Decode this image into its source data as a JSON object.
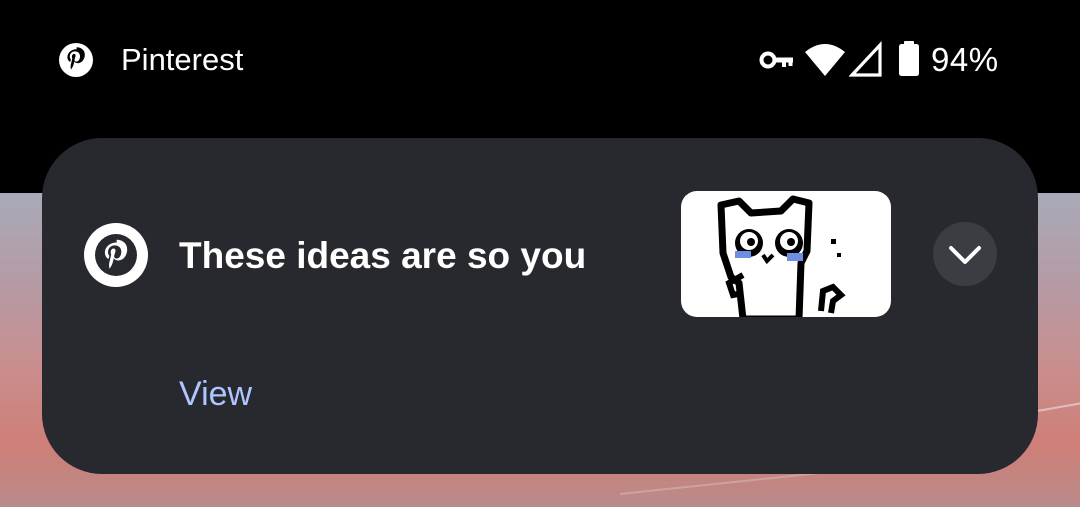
{
  "status_bar": {
    "app_name": "Pinterest",
    "app_icon": "pinterest-icon",
    "icons": [
      "vpn-key-icon",
      "wifi-icon",
      "cell-signal-icon",
      "battery-icon"
    ],
    "battery_percent": "94%"
  },
  "notification": {
    "app_icon": "pinterest-icon",
    "title": "These ideas are so you",
    "thumbnail": "pixel-cat-image",
    "expand_icon": "chevron-down-icon",
    "action_label": "View"
  },
  "colors": {
    "status_bar_bg": "#000000",
    "card_bg": "#28292e",
    "expand_button_bg": "#3c3d42",
    "action_text": "#aec6ff",
    "title_text": "#ffffff"
  }
}
